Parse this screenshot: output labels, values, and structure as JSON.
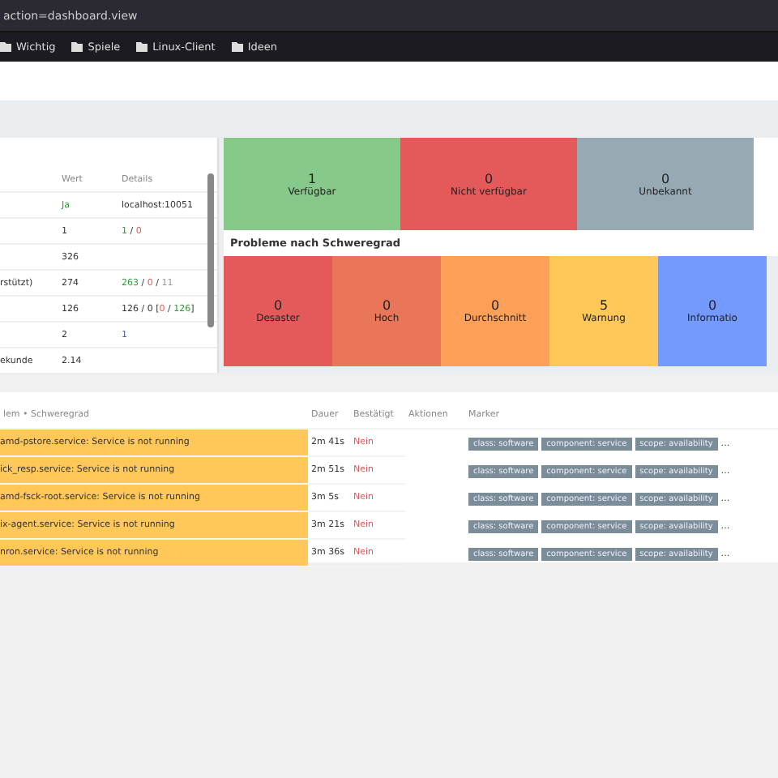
{
  "browser": {
    "url": "action=dashboard.view",
    "bookmarks": [
      {
        "label": "Wichtig"
      },
      {
        "label": "Spiele"
      },
      {
        "label": "Linux-Client"
      },
      {
        "label": "Ideen"
      }
    ]
  },
  "system_info": {
    "columns": [
      "Wert",
      "Details"
    ],
    "rows": [
      {
        "label": "",
        "value": {
          "text": "Ja",
          "kind": "ok"
        },
        "details": [
          {
            "text": "localhost:10051",
            "kind": "plain"
          }
        ]
      },
      {
        "label": "",
        "value": {
          "text": "1",
          "kind": "plain"
        },
        "details": [
          {
            "text": "1",
            "kind": "ok"
          },
          {
            "text": " / ",
            "kind": "plain"
          },
          {
            "text": "0",
            "kind": "bad"
          }
        ]
      },
      {
        "label": "",
        "value": {
          "text": "326",
          "kind": "plain"
        },
        "details": []
      },
      {
        "label": "rstützt)",
        "value": {
          "text": "274",
          "kind": "plain"
        },
        "details": [
          {
            "text": "263",
            "kind": "ok"
          },
          {
            "text": " / ",
            "kind": "plain"
          },
          {
            "text": "0",
            "kind": "bad"
          },
          {
            "text": " / ",
            "kind": "plain"
          },
          {
            "text": "11",
            "kind": "muted"
          }
        ]
      },
      {
        "label": "",
        "value": {
          "text": "126",
          "kind": "plain"
        },
        "details": [
          {
            "text": "126 / 0 [",
            "kind": "plain"
          },
          {
            "text": "0",
            "kind": "bad"
          },
          {
            "text": " / ",
            "kind": "plain"
          },
          {
            "text": "126",
            "kind": "ok"
          },
          {
            "text": "]",
            "kind": "plain"
          }
        ]
      },
      {
        "label": "",
        "value": {
          "text": "2",
          "kind": "plain"
        },
        "details": [
          {
            "text": "1",
            "kind": "link"
          }
        ]
      },
      {
        "label": "ekunde",
        "value": {
          "text": "2.14",
          "kind": "plain"
        },
        "details": []
      }
    ]
  },
  "availability": [
    {
      "count": "1",
      "label": "Verfügbar",
      "color": "#86c98a"
    },
    {
      "count": "0",
      "label": "Nicht verfügbar",
      "color": "#e45959"
    },
    {
      "count": "0",
      "label": "Unbekannt",
      "color": "#97aab3"
    }
  ],
  "severity": {
    "title": "Probleme nach Schweregrad",
    "items": [
      {
        "count": "0",
        "label": "Desaster",
        "color": "#e45959"
      },
      {
        "count": "0",
        "label": "Hoch",
        "color": "#e97659"
      },
      {
        "count": "0",
        "label": "Durchschnitt",
        "color": "#ffa059"
      },
      {
        "count": "5",
        "label": "Warnung",
        "color": "#ffc859"
      },
      {
        "count": "0",
        "label": "Informatio",
        "color": "#7499ff"
      }
    ]
  },
  "problems": {
    "columns": [
      "lem • Schweregrad",
      "Dauer",
      "Bestätigt",
      "Aktionen",
      "Marker"
    ],
    "rows": [
      {
        "problem": "amd-pstore.service: Service is not running",
        "duration": "2m 41s",
        "ack": "Nein",
        "tags": [
          "class: software",
          "component: service",
          "scope: availability"
        ],
        "more": "…"
      },
      {
        "problem": "ick_resp.service: Service is not running",
        "duration": "2m 51s",
        "ack": "Nein",
        "tags": [
          "class: software",
          "component: service",
          "scope: availability"
        ],
        "more": "…"
      },
      {
        "problem": "amd-fsck-root.service: Service is not running",
        "duration": "3m 5s",
        "ack": "Nein",
        "tags": [
          "class: software",
          "component: service",
          "scope: availability"
        ],
        "more": "…"
      },
      {
        "problem": "ix-agent.service: Service is not running",
        "duration": "3m 21s",
        "ack": "Nein",
        "tags": [
          "class: software",
          "component: service",
          "scope: availability"
        ],
        "more": "…"
      },
      {
        "problem": "nron.service: Service is not running",
        "duration": "3m 36s",
        "ack": "Nein",
        "tags": [
          "class: software",
          "component: service",
          "scope: availability"
        ],
        "more": "…"
      }
    ]
  }
}
